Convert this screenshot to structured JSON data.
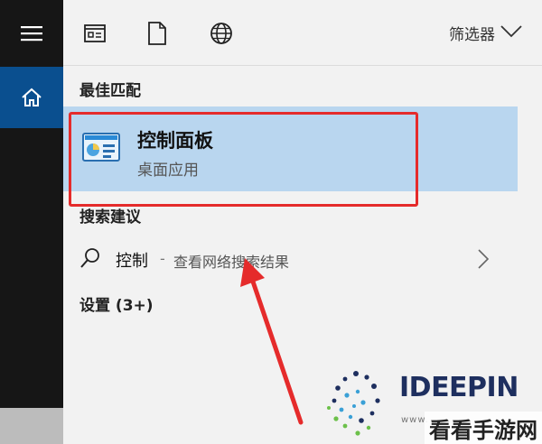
{
  "sidebar": {
    "menu_icon": "hamburger-icon",
    "home_icon": "home-icon"
  },
  "topbar": {
    "icons": [
      "documents-icon",
      "file-icon",
      "globe-icon"
    ],
    "filter_label": "筛选器",
    "filter_icon": "chevron-down-icon"
  },
  "sections": {
    "best_match": "最佳匹配",
    "search_suggestions": "搜索建议",
    "settings": "设置 (3+)"
  },
  "best_match_item": {
    "title": "控制面板",
    "subtitle": "桌面应用",
    "icon": "control-panel-icon"
  },
  "web_suggestion": {
    "term": "控制",
    "separator": "-",
    "description": "查看网络搜索结果",
    "icon": "search-icon"
  },
  "watermark": {
    "brand": "IDEEPIN",
    "url": "www.",
    "tag": "看看手游网"
  },
  "colors": {
    "sidebar": "#161616",
    "home_tile": "#0a4f8f",
    "selected_row": "#b9d6ef",
    "annotation_red": "#e52b2b"
  }
}
